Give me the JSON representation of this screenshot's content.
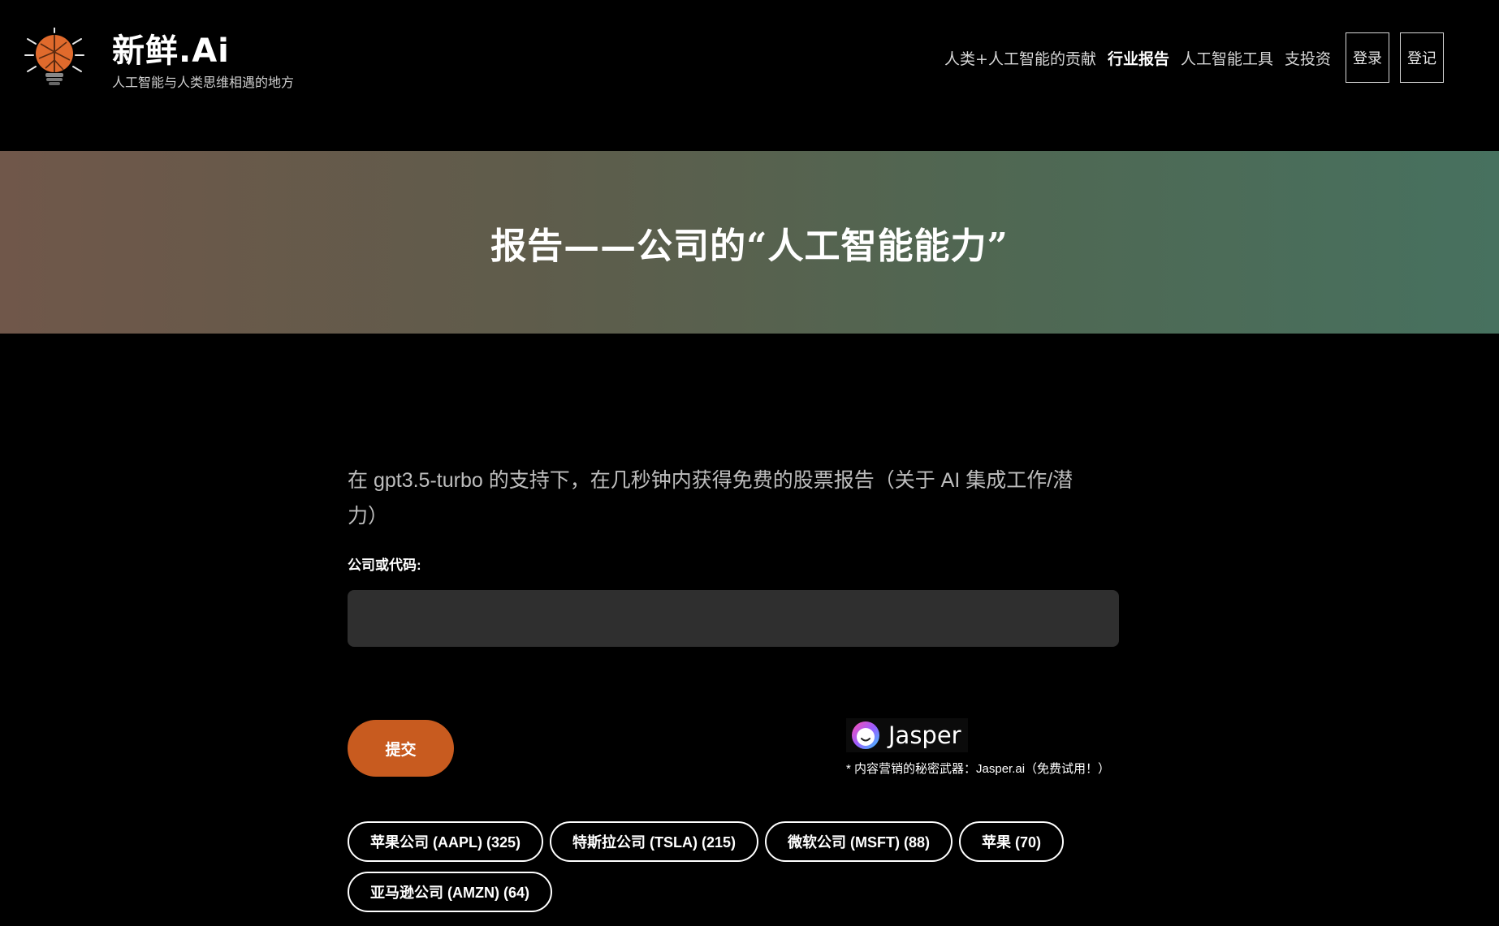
{
  "header": {
    "brand_title": "新鲜.Ai",
    "brand_tagline": "人工智能与人类思维相遇的地方",
    "nav": [
      {
        "label": "人类+人工智能的贡献"
      },
      {
        "label": "行业报告"
      },
      {
        "label": "人工智能工具"
      },
      {
        "label": "支投资"
      }
    ],
    "login_label": "登录",
    "register_label": "登记"
  },
  "hero": {
    "title": "报告——公司的“人工智能能力”"
  },
  "main": {
    "intro": "在 gpt3.5-turbo 的支持下，在几秒钟内获得免费的股票报告（关于 AI 集成工作/潜力）",
    "field_label": "公司或代码:",
    "input_value": "",
    "input_placeholder": "",
    "submit_label": "提交"
  },
  "sponsor": {
    "name": "Jasper",
    "note": "* 内容营销的秘密武器：Jasper.ai（免费试用！）"
  },
  "chips": [
    {
      "label": "苹果公司 (AAPL) (325)"
    },
    {
      "label": "特斯拉公司 (TSLA) (215)"
    },
    {
      "label": "微软公司 (MSFT) (88)"
    },
    {
      "label": "苹果 (70)"
    },
    {
      "label": "亚马逊公司 (AMZN) (64)"
    }
  ],
  "colors": {
    "accent": "#c85b1f",
    "input_bg": "#2f2f2f",
    "hero_left": "#70574a",
    "hero_right": "#47715f"
  },
  "icons": {
    "logo": "brain-lightbulb-icon",
    "sponsor": "jasper-logo-icon"
  }
}
